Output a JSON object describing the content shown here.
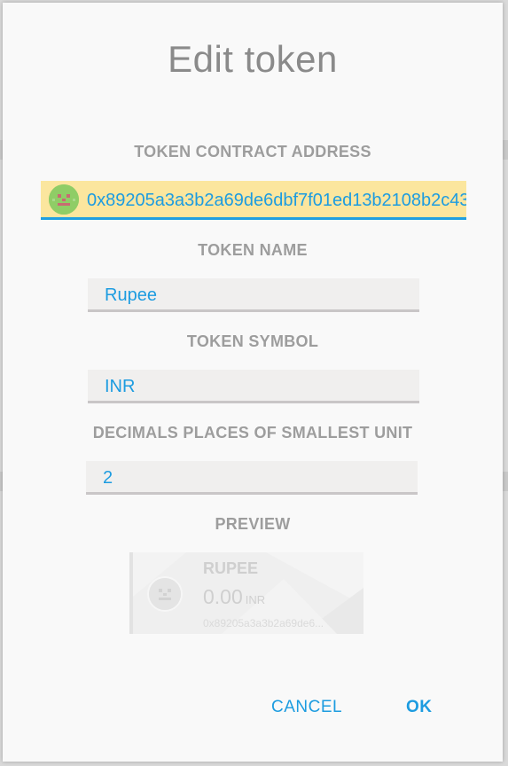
{
  "dialog": {
    "title": "Edit token"
  },
  "fields": {
    "contract_address": {
      "label": "TOKEN CONTRACT ADDRESS",
      "value": "0x89205a3a3b2a69de6dbf7f01ed13b2108b2c43"
    },
    "token_name": {
      "label": "TOKEN NAME",
      "value": "Rupee"
    },
    "token_symbol": {
      "label": "TOKEN SYMBOL",
      "value": "INR"
    },
    "decimals": {
      "label": "DECIMALS PLACES OF SMALLEST UNIT",
      "value": "2"
    }
  },
  "preview": {
    "label": "PREVIEW",
    "name": "RUPEE",
    "amount": "0.00",
    "symbol": "INR",
    "address": "0x89205a3a3b2a69de6..."
  },
  "buttons": {
    "cancel": "CANCEL",
    "ok": "OK"
  },
  "colors": {
    "accent": "#1d9ce0",
    "address_highlight": "#fbe69e",
    "identicon": "#8fcd66",
    "label": "#9d9d9d"
  }
}
